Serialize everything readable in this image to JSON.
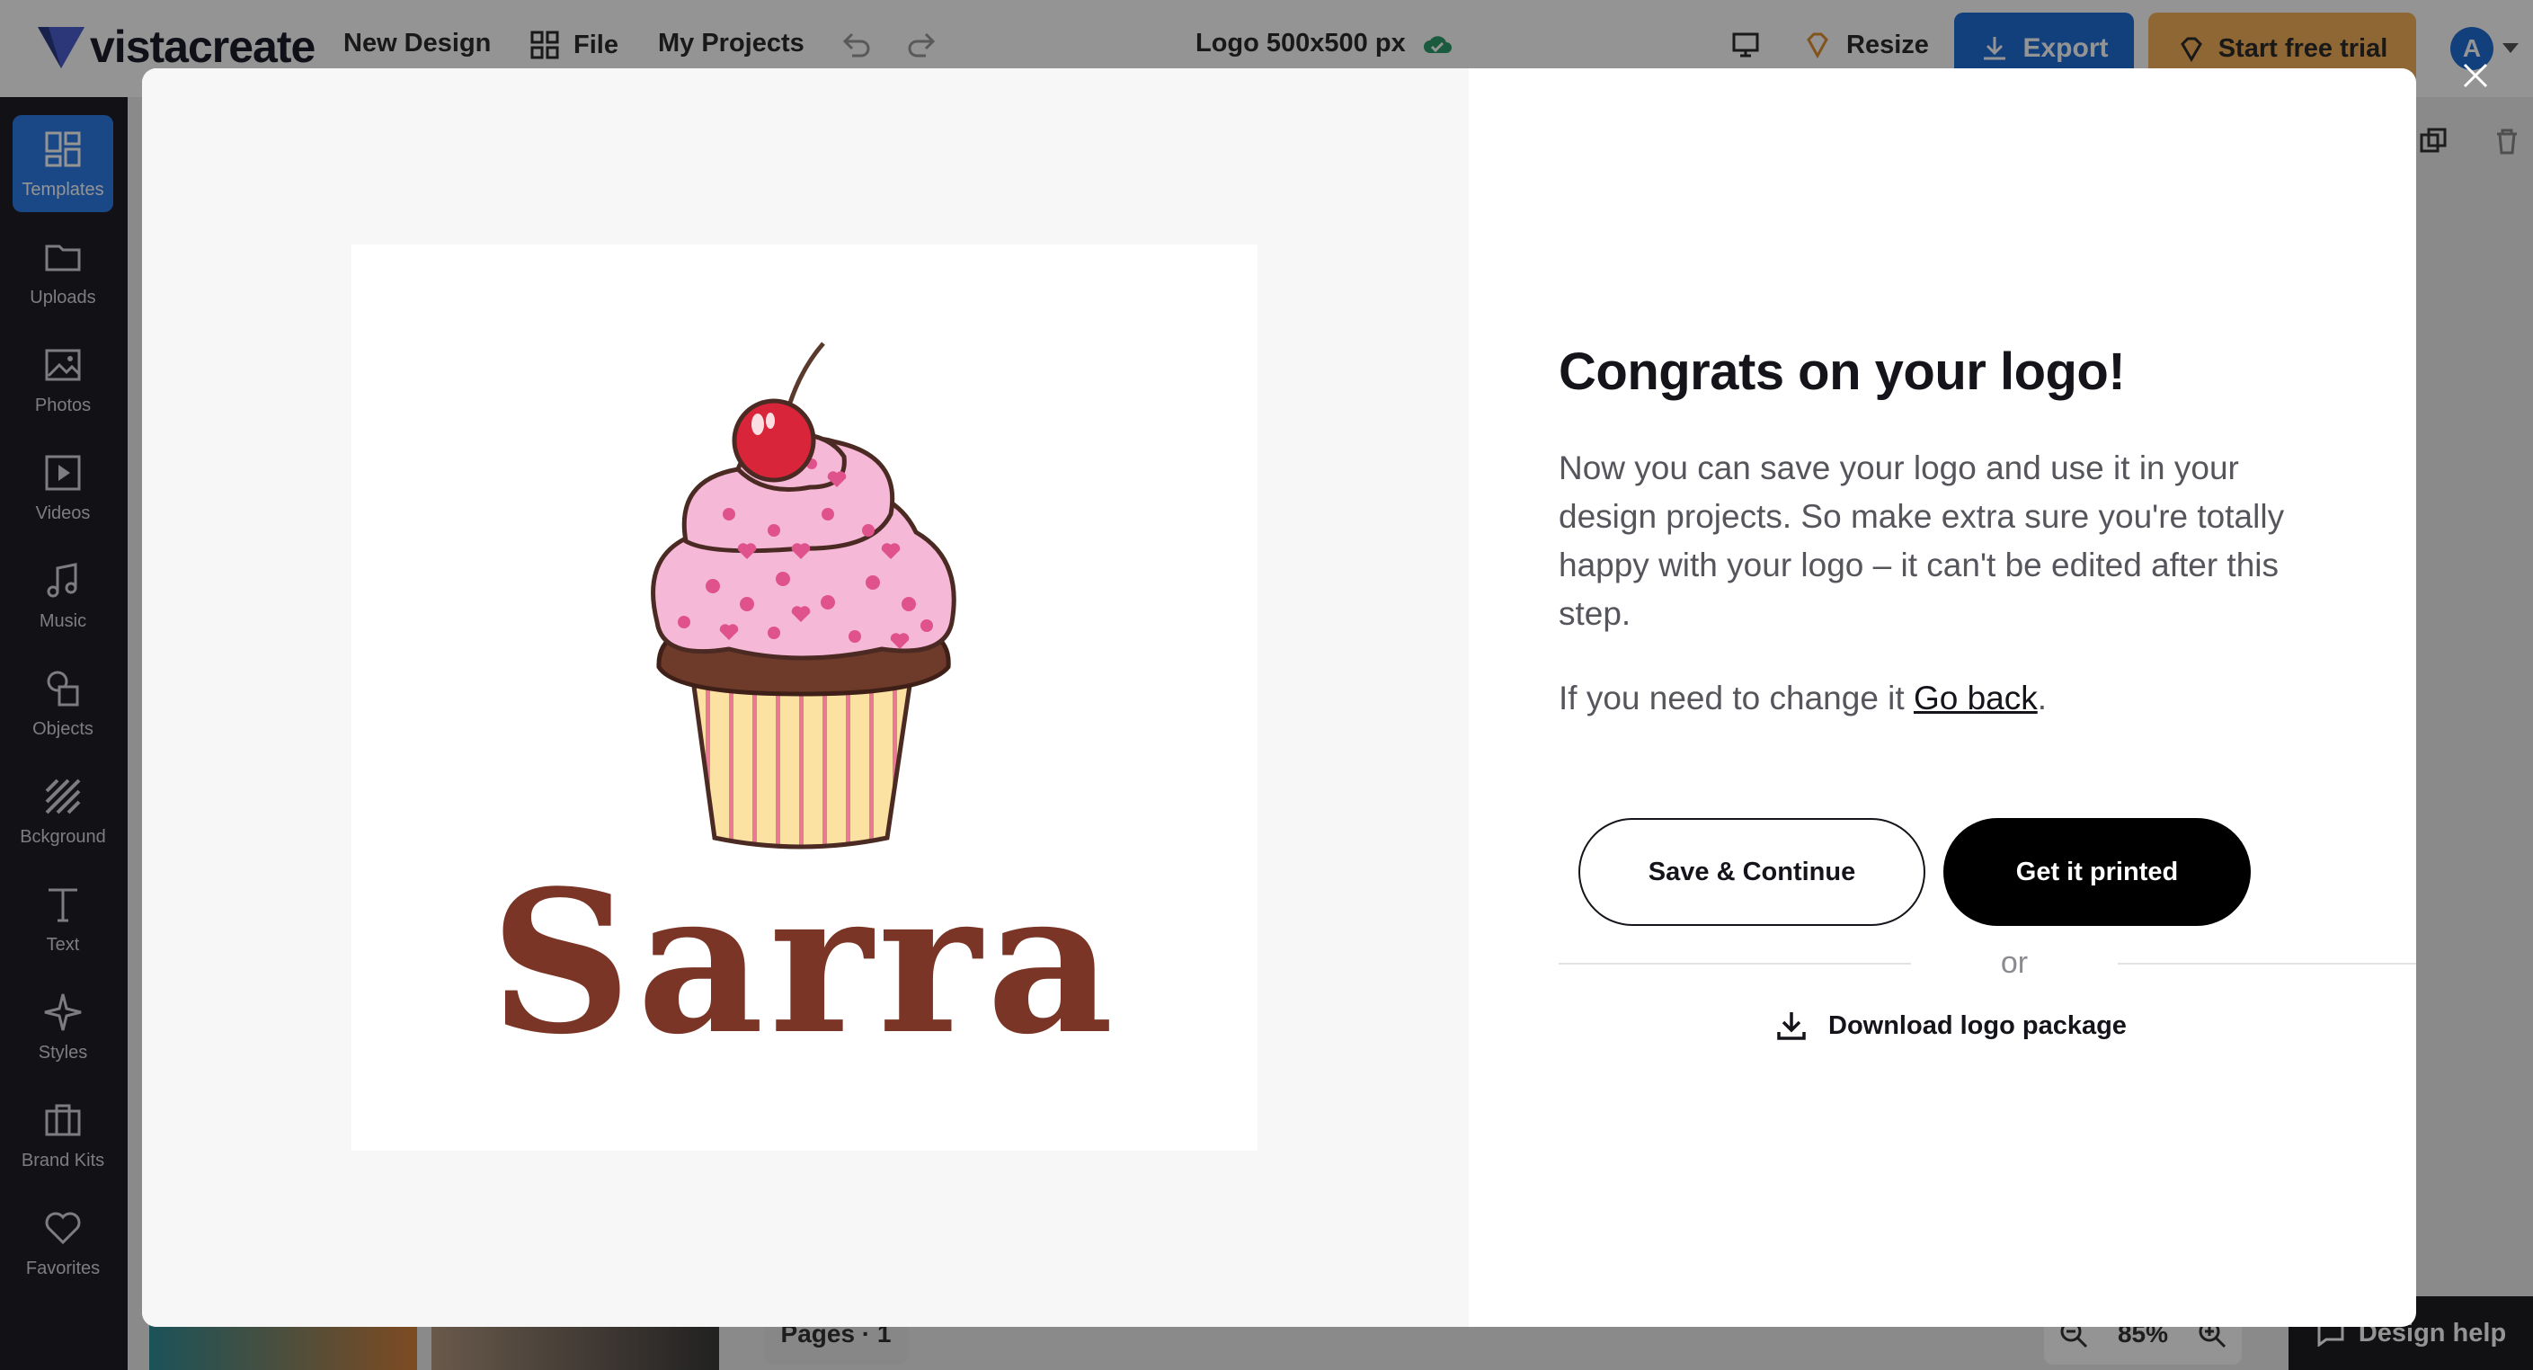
{
  "app": {
    "brand_name": "vistacreate",
    "nav": {
      "new_design": "New Design",
      "file": "File",
      "my_projects": "My Projects"
    },
    "document_title": "Logo 500x500 px",
    "resize_label": "Resize",
    "export_label": "Export",
    "trial_label": "Start free trial",
    "avatar_initial": "A",
    "colors": {
      "accent": "#1f6fd8",
      "trial": "#f6b25a",
      "sidebar": "#1f1f27"
    }
  },
  "sidebar": {
    "items": [
      {
        "label": "Templates",
        "icon": "grid-icon"
      },
      {
        "label": "Uploads",
        "icon": "folder-icon"
      },
      {
        "label": "Photos",
        "icon": "image-icon"
      },
      {
        "label": "Videos",
        "icon": "play-icon"
      },
      {
        "label": "Music",
        "icon": "music-icon"
      },
      {
        "label": "Objects",
        "icon": "shapes-icon"
      },
      {
        "label": "Bckground",
        "icon": "stripes-icon"
      },
      {
        "label": "Text",
        "icon": "text-icon"
      },
      {
        "label": "Styles",
        "icon": "sparkle-icon"
      },
      {
        "label": "Brand Kits",
        "icon": "briefcase-icon"
      },
      {
        "label": "Favorites",
        "icon": "heart-icon"
      }
    ]
  },
  "footer": {
    "pages_label": "Pages · 1",
    "zoom": "85%",
    "design_help": "Design help"
  },
  "modal": {
    "logo_text": "Sarra",
    "title": "Congrats on your logo!",
    "description": "Now you can save your logo and use it in your design projects. So make extra sure you're totally happy with your logo – it can't be edited after this step.",
    "back_prefix": "If you need to change it ",
    "back_link": "Go back",
    "back_suffix": ".",
    "save_button": "Save & Continue",
    "print_button": "Get it printed",
    "or_text": "or",
    "download_label": "Download logo package"
  }
}
